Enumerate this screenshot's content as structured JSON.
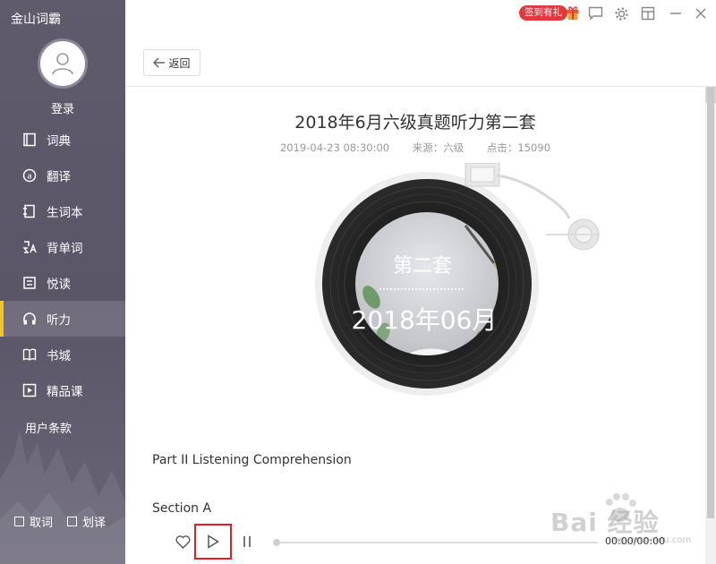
{
  "app": {
    "title": "金山词霸"
  },
  "sidebar": {
    "login_label": "登录",
    "items": [
      {
        "label": "词典",
        "icon": "book-icon"
      },
      {
        "label": "翻译",
        "icon": "translate-icon"
      },
      {
        "label": "生词本",
        "icon": "notebook-icon"
      },
      {
        "label": "背单词",
        "icon": "vocab-icon"
      },
      {
        "label": "悦读",
        "icon": "reading-icon"
      },
      {
        "label": "听力",
        "icon": "headphones-icon",
        "active": true
      },
      {
        "label": "书城",
        "icon": "bookstore-icon"
      },
      {
        "label": "精品课",
        "icon": "course-icon"
      }
    ],
    "terms_label": "用户条款",
    "checkbox_fetch_label": "取词",
    "checkbox_select_label": "划译",
    "active_color": "#f5c518"
  },
  "topbar": {
    "signin_badge": "签到有礼",
    "badge_color": "#e4393c"
  },
  "back_button": {
    "label": "返回"
  },
  "article": {
    "title": "2018年6月六级真题听力第二套",
    "date": "2019-04-23 08:30:00",
    "source": "来源：六级",
    "clicks": "点击：15090",
    "record_label_top": "第二套",
    "record_label_bottom": "2018年06月",
    "part_heading": "Part II Listening Comprehension",
    "section_heading": "Section A"
  },
  "player": {
    "time": "00:00/00:00",
    "progress": 0
  },
  "watermark": {
    "text": "Bai 经验",
    "sub": "jingyan.baidu.com"
  }
}
